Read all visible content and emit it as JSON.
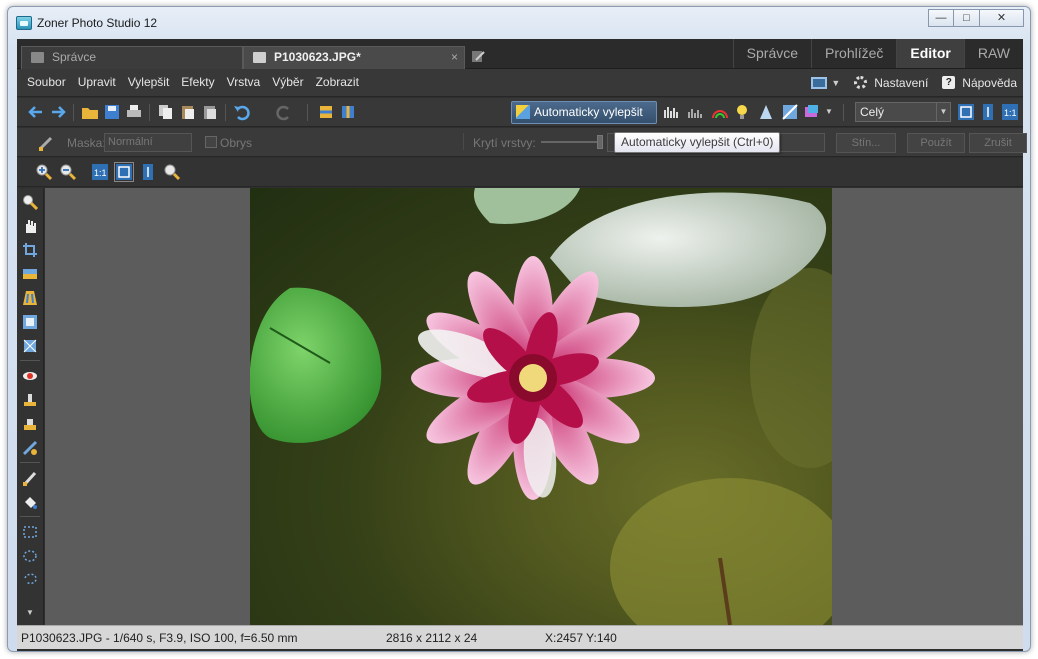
{
  "window": {
    "title": "Zoner Photo Studio 12",
    "minimize": "—",
    "maximize": "□",
    "close": "✕"
  },
  "tabs": [
    {
      "label": "Správce",
      "icon": "folder-icon"
    },
    {
      "label": "P1030623.JPG*",
      "icon": "edit-icon",
      "close": "×"
    }
  ],
  "modes": [
    "Správce",
    "Prohlížeč",
    "Editor",
    "RAW"
  ],
  "active_mode": "Editor",
  "menu": [
    "Soubor",
    "Upravit",
    "Vylepšit",
    "Efekty",
    "Vrstva",
    "Výběr",
    "Zobrazit"
  ],
  "menu_right": {
    "settings": "Nastavení",
    "help": "Nápověda",
    "help_glyph": "?"
  },
  "toolbar": {
    "auto_enhance": "Automaticky vylepšit",
    "zoom_value": "Celý",
    "dropdown_glyph": "▼"
  },
  "options": {
    "mask_label": "Maska:",
    "mask_value": "Normální",
    "outline_label": "Obrys",
    "opacity_label": "Krytí vrstvy:",
    "shadow_button": "Stín...",
    "apply_button": "Použít",
    "cancel_button": "Zrušit"
  },
  "tooltip": "Automaticky vylepšit (Ctrl+0)",
  "status": {
    "file_info": "P1030623.JPG - 1/640 s, F3.9, ISO 100, f=6.50 mm",
    "dimensions": "2816 x 2112 x 24",
    "coords": "X:2457  Y:140"
  },
  "colors": {
    "accent": "#4c6a8c",
    "app_bg": "#2f2f2f",
    "canvas_bg": "#5c5c5c"
  }
}
